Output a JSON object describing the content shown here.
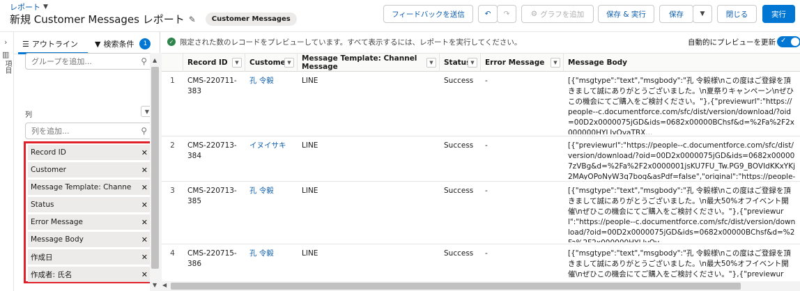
{
  "header": {
    "breadcrumb": "レポート",
    "title": "新規 Customer Messages レポート",
    "badge": "Customer Messages",
    "buttons": {
      "feedback": "フィードバックを送信",
      "undo": "↶",
      "redo": "↷",
      "add_chart": "グラフを追加",
      "save_run": "保存 & 実行",
      "save": "保存",
      "save_menu": "▼",
      "close": "閉じる",
      "run": "実行"
    }
  },
  "rail": {
    "label": "項目"
  },
  "panel": {
    "tabs": {
      "outline": "アウトライン",
      "filters": "検索条件",
      "filter_count": "1"
    },
    "group_search_placeholder": "グループを追加...",
    "columns_label": "列",
    "column_search_placeholder": "列を追加...",
    "columns": [
      "Record ID",
      "Customer",
      "Message Template: Channel Message",
      "Status",
      "Error Message",
      "Message Body",
      "作成日",
      "作成者: 氏名"
    ]
  },
  "notice": {
    "message": "限定された数のレコードをプレビューしています。すべて表示するには、レポートを実行してください。",
    "auto_preview": "自動的にプレビューを更新"
  },
  "table": {
    "headers": [
      "Record ID",
      "Customer",
      "Message Template: Channel Message",
      "Status",
      "Error Message",
      "Message Body"
    ],
    "rows": [
      {
        "num": "1",
        "record_id": "CMS-220711-383",
        "customer": "孔 令毅",
        "template": "LINE",
        "status": "Success",
        "error": "-",
        "body": "[{\"msgtype\":\"text\",\"msgbody\":\"孔 令毅様\\nこの度はご登録を頂きまして誠にありがとうございました。\\n夏祭りキャンペーン\\nぜひこの機会にてご購入をご検討ください。\"},{\"previewurl\":\"https://people--c.documentforce.com/sfc/dist/version/download/?oid=00D2x0000075jGD&ids=0682x00000BChsf&d=%2Fa%2F2x000000HYLIyQvaTBX..."
      },
      {
        "num": "2",
        "record_id": "CMS-220713-384",
        "customer": "イヌイサキ",
        "template": "LINE",
        "status": "Success",
        "error": "-",
        "body": "[{\"previewurl\":\"https://people--c.documentforce.com/sfc/dist/version/download/?oid=00D2x0000075jGD&ids=0682x000007zVBg&d=%2Fa%2F2x0000001jsKU7FU_Tw.PG9_BOVIdKKxYKj2MAyOPoNyW3q7bog&asPdf=false\",\"original\":\"https://people--c.documentforce.com/sfc/d..."
      },
      {
        "num": "3",
        "record_id": "CMS-220713-385",
        "customer": "孔 令毅",
        "template": "LINE",
        "status": "Success",
        "error": "-",
        "body": "[{\"msgtype\":\"text\",\"msgbody\":\"孔 令毅様\\nこの度はご登録を頂きまして誠にありがとうございました。\\n最大50%オフイベント開催\\nぜひこの機会にてご購入をご検討ください。\"},{\"previewurl\":\"https://people--c.documentforce.com/sfc/dist/version/download/?oid=00D2x0000075jGD&ids=0682x00000BChsf&d=%2Fa%2F2x000000HYLIyQv..."
      },
      {
        "num": "4",
        "record_id": "CMS-220715-386",
        "customer": "孔 令毅",
        "template": "LINE",
        "status": "Success",
        "error": "-",
        "body": "[{\"msgtype\":\"text\",\"msgbody\":\"孔 令毅様\\nこの度はご登録を頂きまして誠にありがとうございました。\\n最大50%オフイベント開催\\nぜひこの機会にてご購入をご検討ください。\"},{\"previewurl\":\"https://people--c.documentforce.com/sfc/dist/version/download/?..."
      }
    ]
  },
  "colors": {
    "accent": "#0176d3",
    "link": "#0b5cab",
    "highlight_border": "#e0202a",
    "success": "#2e844a"
  },
  "icons": [
    "caret-down-icon",
    "pencil-icon",
    "undo-icon",
    "redo-icon",
    "chart-icon",
    "list-icon",
    "filter-icon",
    "search-icon",
    "close-icon",
    "check-circle-icon",
    "chevron-right-icon"
  ]
}
